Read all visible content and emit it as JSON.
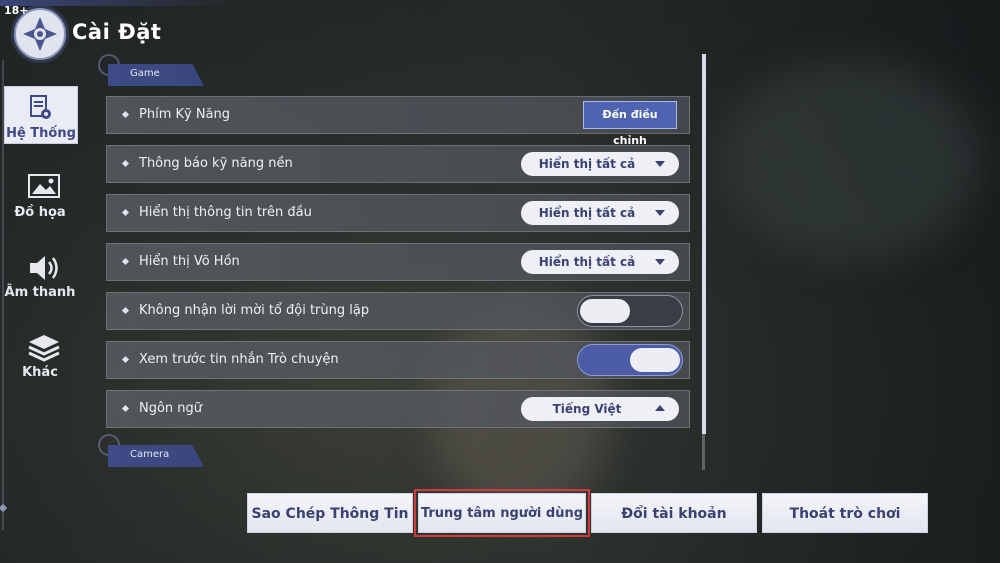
{
  "header": {
    "age_rating": "18+",
    "title": "Cài Đặt"
  },
  "nav": {
    "items": [
      {
        "label": "Hệ Thống",
        "icon": "document-settings-icon",
        "active": true
      },
      {
        "label": "Đồ họa",
        "icon": "image-icon",
        "active": false
      },
      {
        "label": "Âm thanh",
        "icon": "speaker-icon",
        "active": false
      },
      {
        "label": "Khác",
        "icon": "layers-icon",
        "active": false
      }
    ]
  },
  "sections": {
    "game": "Game",
    "camera": "Camera"
  },
  "settings": [
    {
      "label": "Phím Kỹ Năng",
      "control": "button",
      "value": "Đến điều chỉnh"
    },
    {
      "label": "Thông báo kỹ năng nền",
      "control": "dropdown",
      "value": "Hiển thị tất cả"
    },
    {
      "label": "Hiển thị thông tin trên đầu",
      "control": "dropdown",
      "value": "Hiển thị tất cả"
    },
    {
      "label": "Hiển thị Võ Hồn",
      "control": "dropdown",
      "value": "Hiển thị tất cả"
    },
    {
      "label": "Không nhận lời mời tổ đội trùng lặp",
      "control": "toggle",
      "value": "off"
    },
    {
      "label": "Xem trước tin nhắn Trò chuyện",
      "control": "toggle",
      "value": "on"
    },
    {
      "label": "Ngôn ngữ",
      "control": "dropdown",
      "value": "Tiếng Việt"
    }
  ],
  "footer": {
    "copy_info": "Sao Chép Thông Tin",
    "user_center": "Trung tâm người dùng",
    "switch_account": "Đổi tài khoản",
    "exit_game": "Thoát trò chơi"
  },
  "colors": {
    "accent": "#4f64b0",
    "highlight": "#cf3c3c",
    "panel_text": "#3b4272"
  }
}
